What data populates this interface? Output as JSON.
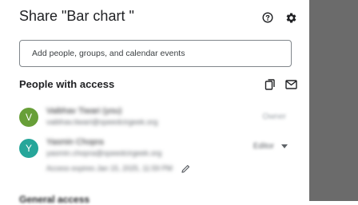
{
  "dialog": {
    "title": "Share \"Bar chart \""
  },
  "icons": {
    "help": "help-circle-icon",
    "settings": "gear-icon",
    "copy": "copy-link-icon",
    "email": "email-icon",
    "edit": "pencil-icon"
  },
  "add_people": {
    "placeholder": "Add people, groups, and calendar events"
  },
  "people_section": {
    "title": "People with access"
  },
  "people": [
    {
      "initial": "V",
      "avatar_color": "#689f38",
      "name": "Vaibhav Tiwari (you)",
      "email": "vaibhav.tiwari@speedcirgeek.org",
      "role": "Owner"
    },
    {
      "initial": "Y",
      "avatar_color": "#26a69a",
      "name": "Yasmin Chopra",
      "email": "yasmin.chopra@speedcirgeek.org",
      "role": "Editor"
    }
  ],
  "expiry": {
    "text": "Access expires Jan 15, 2025, 11:59 PM"
  },
  "general_access": {
    "title": "General access"
  },
  "colors": {
    "backdrop": "#6b6b6b",
    "text_primary": "#202124",
    "text_secondary": "#5f6368"
  }
}
